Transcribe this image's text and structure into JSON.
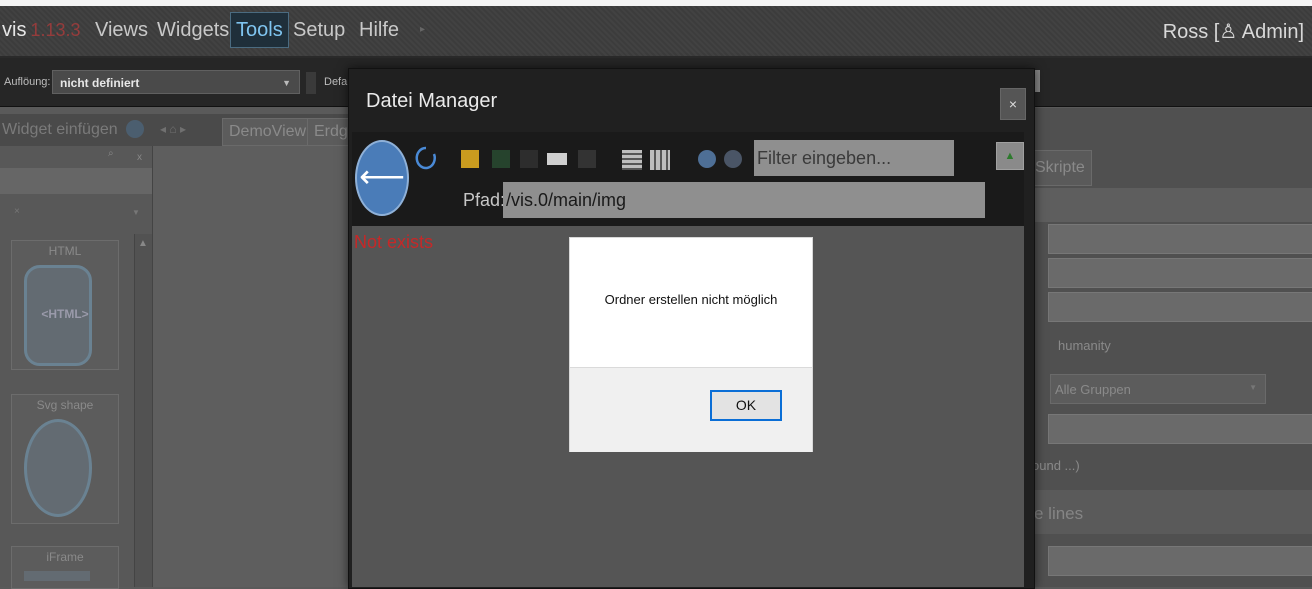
{
  "app": {
    "brand": "vis",
    "version": "1.13.3"
  },
  "menu": {
    "items": [
      "Views",
      "Widgets",
      "Tools",
      "Setup",
      "Hilfe"
    ],
    "active": "Tools"
  },
  "user": {
    "label": "Ross [♙ Admin]"
  },
  "toolbar": {
    "resolution_label": "Auflöung:",
    "resolution_value": "nicht definiert",
    "default_label": "Defa"
  },
  "tabs_row": {
    "widget_insert": "Widget einfügen",
    "views": [
      "DemoView",
      "Erdg"
    ]
  },
  "widget_list": [
    {
      "label": "HTML",
      "preview": "<HTML>"
    },
    {
      "label": "Svg shape"
    },
    {
      "label": "iFrame"
    }
  ],
  "right_panel": {
    "tab": "Skripte",
    "theme": "humanity",
    "group": "Alle Gruppen",
    "background": "ound ...)",
    "section": "e lines"
  },
  "file_manager": {
    "title": "Datei Manager",
    "close_label": "×",
    "filter_placeholder": "Filter eingeben...",
    "path_label": "Pfad:",
    "path_value": "/vis.0/main/img",
    "status": "Not exists"
  },
  "alert": {
    "message": "Ordner erstellen nicht möglich",
    "ok_label": "OK"
  },
  "colors": {
    "active_tab": "#7fc4ef",
    "error": "#c62828",
    "ok_border": "#0a6ed6",
    "back_button": "#4a7cb8"
  }
}
